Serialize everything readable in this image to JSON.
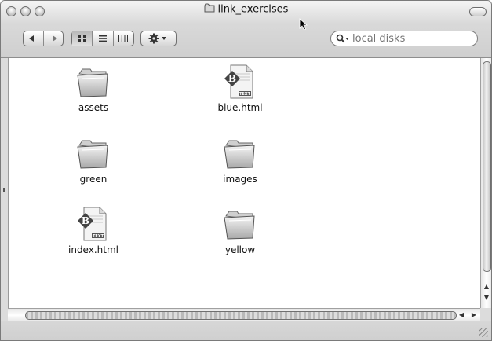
{
  "window": {
    "title": "link_exercises"
  },
  "toolbar": {
    "back_icon": "back-arrow-icon",
    "forward_icon": "forward-arrow-icon",
    "view_icons": [
      "icon-view-icon",
      "list-view-icon",
      "column-view-icon"
    ],
    "action_icon": "gear-icon",
    "search_placeholder": "local disks"
  },
  "files": [
    {
      "name": "assets",
      "type": "folder"
    },
    {
      "name": "blue.html",
      "type": "bbedit-document"
    },
    {
      "name": "green",
      "type": "folder"
    },
    {
      "name": "images",
      "type": "folder"
    },
    {
      "name": "index.html",
      "type": "bbedit-document"
    },
    {
      "name": "yellow",
      "type": "folder"
    }
  ],
  "doc_icon": {
    "letter": "B",
    "badge": "TEXT"
  }
}
